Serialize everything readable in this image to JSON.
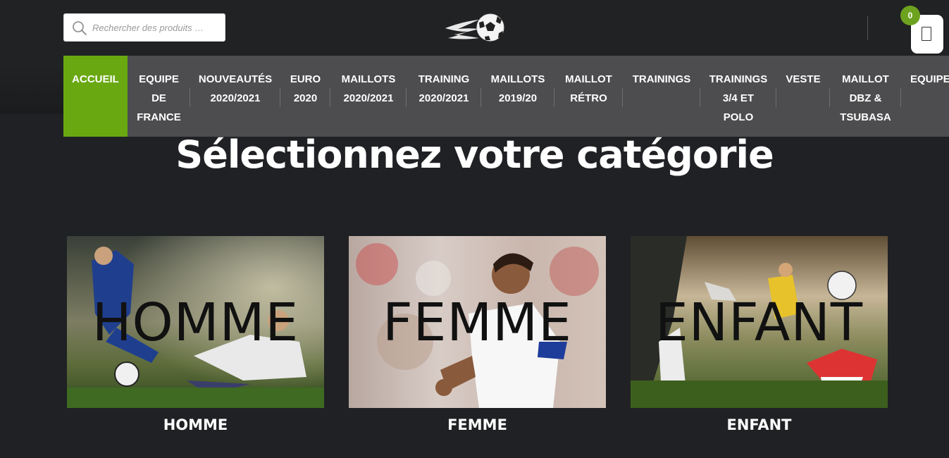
{
  "search": {
    "placeholder": "Rechercher des produits …"
  },
  "cart": {
    "count": "0"
  },
  "nav": [
    {
      "lines": [
        "ACCUEIL"
      ]
    },
    {
      "lines": [
        "EQUIPE",
        "DE",
        "FRANCE"
      ]
    },
    {
      "lines": [
        "NOUVEAUTÉS",
        "2020/2021"
      ]
    },
    {
      "lines": [
        "EURO",
        "2020"
      ]
    },
    {
      "lines": [
        "MAILLOTS",
        "2020/2021"
      ]
    },
    {
      "lines": [
        "TRAINING",
        "2020/2021"
      ]
    },
    {
      "lines": [
        "MAILLOTS",
        "2019/20"
      ]
    },
    {
      "lines": [
        "MAILLOT",
        "RÉTRO"
      ]
    },
    {
      "lines": [
        "TRAININGS"
      ]
    },
    {
      "lines": [
        "TRAININGS",
        "3/4 ET",
        "POLO"
      ]
    },
    {
      "lines": [
        "VESTE"
      ]
    },
    {
      "lines": [
        "MAILLOT",
        "DBZ &",
        "TSUBASA"
      ]
    },
    {
      "lines": [
        "EQUIPE"
      ]
    }
  ],
  "heading": "Sélectionnez votre catégorie",
  "categories": [
    {
      "overlay": "HOMME",
      "caption": "HOMME"
    },
    {
      "overlay": "FEMME",
      "caption": "FEMME"
    },
    {
      "overlay": "ENFANT",
      "caption": "ENFANT"
    }
  ],
  "colors": {
    "accent": "#6aa812",
    "nav_bg": "#4d4d4f",
    "page_bg": "#202124"
  }
}
